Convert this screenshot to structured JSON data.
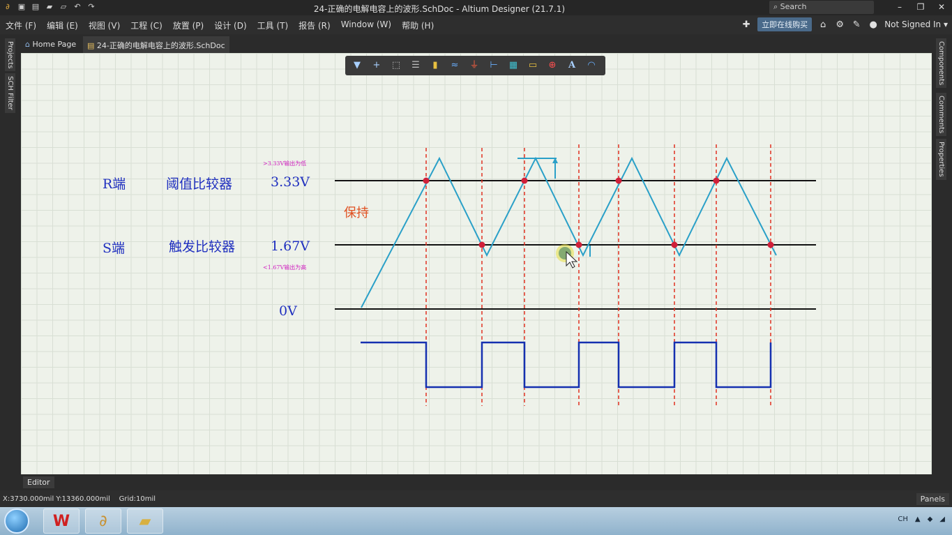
{
  "titlebar": {
    "title": "24-正确的电解电容上的波形.SchDoc - Altium Designer (21.7.1)",
    "search_placeholder": "Search",
    "minimize": "–",
    "restore": "❐",
    "close": "✕"
  },
  "menubar": {
    "items": [
      "文件 (F)",
      "编辑 (E)",
      "视图 (V)",
      "工程 (C)",
      "放置 (P)",
      "设计 (D)",
      "工具 (T)",
      "报告 (R)",
      "Window (W)",
      "帮助 (H)"
    ],
    "buy_label": "立即在线购买",
    "signin_label": "Not Signed In ▾"
  },
  "left_panels": [
    "Projects",
    "SCH Filter"
  ],
  "right_panels": [
    "Components",
    "Comments",
    "Properties"
  ],
  "tabs": [
    {
      "label": "Home Page"
    },
    {
      "label": "24-正确的电解电容上的波形.SchDoc"
    }
  ],
  "schematic": {
    "r_terminal": "R端",
    "threshold_comparator": "阈值比较器",
    "v_high": "3.33V",
    "note_high": ">3.33V输出为低",
    "hold": "保持",
    "s_terminal": "S端",
    "trigger_comparator": "触发比较器",
    "v_low": "1.67V",
    "note_low": "<1.67V输出为高",
    "v_zero": "0V",
    "colors": {
      "label_blue": "#1f2fbf",
      "wave_cyan": "#2aa0c8",
      "square_blue": "#1530b0",
      "marker_red": "#d0203a",
      "dash_red": "#e03020",
      "note_magenta": "#d020c0",
      "hold_orange": "#e05020"
    }
  },
  "editor_tab": "Editor",
  "status": {
    "coords": "X:3730.000mil Y:13360.000mil",
    "grid": "Grid:10mil",
    "panels_button": "Panels"
  },
  "taskbar": {
    "tray": [
      "CH"
    ]
  }
}
